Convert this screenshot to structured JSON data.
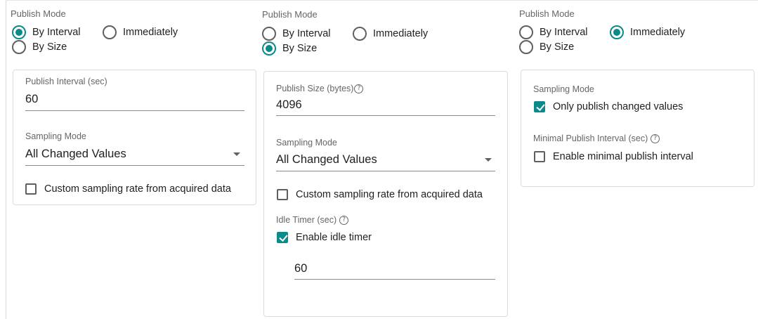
{
  "colors": {
    "accent": "#0a8a8a",
    "border": "#dcdcdc",
    "label": "#666666"
  },
  "panels": [
    {
      "publish_mode_label": "Publish Mode",
      "radios": {
        "by_interval": "By Interval",
        "immediately": "Immediately",
        "by_size": "By Size"
      },
      "selected": "by_interval",
      "publish_interval_label": "Publish Interval (sec)",
      "publish_interval_value": "60",
      "sampling_mode_label": "Sampling Mode",
      "sampling_mode_value": "All Changed Values",
      "custom_sampling_label": "Custom sampling rate from acquired data",
      "custom_sampling_checked": false
    },
    {
      "publish_mode_label": "Publish Mode",
      "radios": {
        "by_interval": "By Interval",
        "immediately": "Immediately",
        "by_size": "By Size"
      },
      "selected": "by_size",
      "publish_size_label": "Publish Size (bytes)",
      "help_glyph": "?",
      "publish_size_value": "4096",
      "sampling_mode_label": "Sampling Mode",
      "sampling_mode_value": "All Changed Values",
      "custom_sampling_label": "Custom sampling rate from acquired data",
      "custom_sampling_checked": false,
      "idle_timer_label": "Idle Timer (sec)",
      "enable_idle_timer_label": "Enable idle timer",
      "enable_idle_timer_checked": true,
      "idle_timer_value": "60"
    },
    {
      "publish_mode_label": "Publish Mode",
      "radios": {
        "by_interval": "By Interval",
        "immediately": "Immediately",
        "by_size": "By Size"
      },
      "selected": "immediately",
      "sampling_mode_label": "Sampling Mode",
      "only_changed_label": "Only publish changed values",
      "only_changed_checked": true,
      "minimal_interval_label": "Minimal Publish Interval (sec)",
      "help_glyph": "?",
      "enable_minimal_label": "Enable minimal publish interval",
      "enable_minimal_checked": false
    }
  ]
}
